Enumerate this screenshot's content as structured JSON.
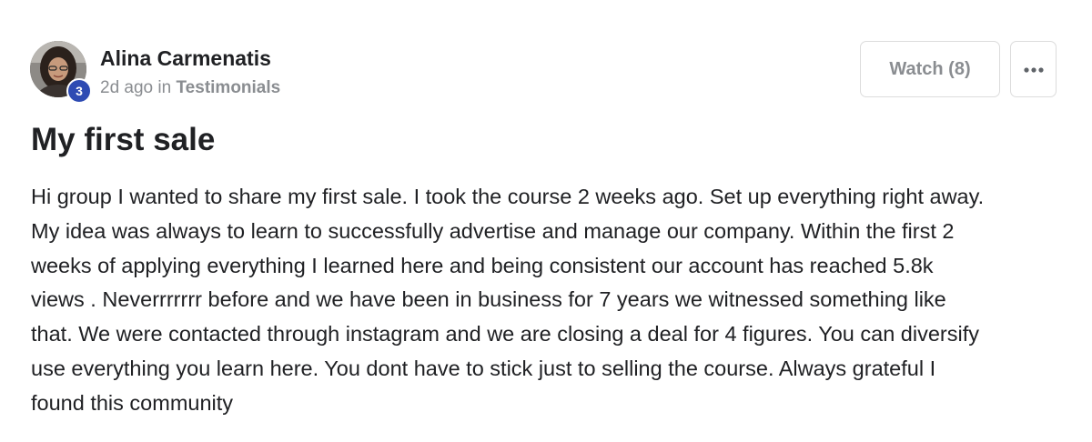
{
  "post": {
    "author": {
      "name": "Alina Carmenatis",
      "level": "3"
    },
    "meta": {
      "time": "2d ago",
      "in_word": "in",
      "category": "Testimonials"
    },
    "actions": {
      "watch_label": "Watch (8)",
      "more_icon": "ellipsis-icon"
    },
    "title": "My first sale",
    "body_lines": [
      "Hi group I wanted to share my first sale. I took the course 2 weeks ago. Set up everything right away.",
      "My idea was always to learn to successfully advertise and manage our company. Within the first 2",
      "weeks of applying everything I learned here and being consistent our account has reached 5.8k",
      "views . Neverrrrrrr before and we have been in business for 7 years we witnessed something like",
      "that. We were contacted through instagram and we are closing a deal for 4 figures. You can diversify",
      "use everything you learn here. You dont have to stick just to selling the course. Always grateful I",
      "found this community"
    ]
  },
  "colors": {
    "text_primary": "#202124",
    "text_muted": "#8a8d91",
    "badge": "#2e4bb3",
    "button_border": "#dcdcdc"
  }
}
